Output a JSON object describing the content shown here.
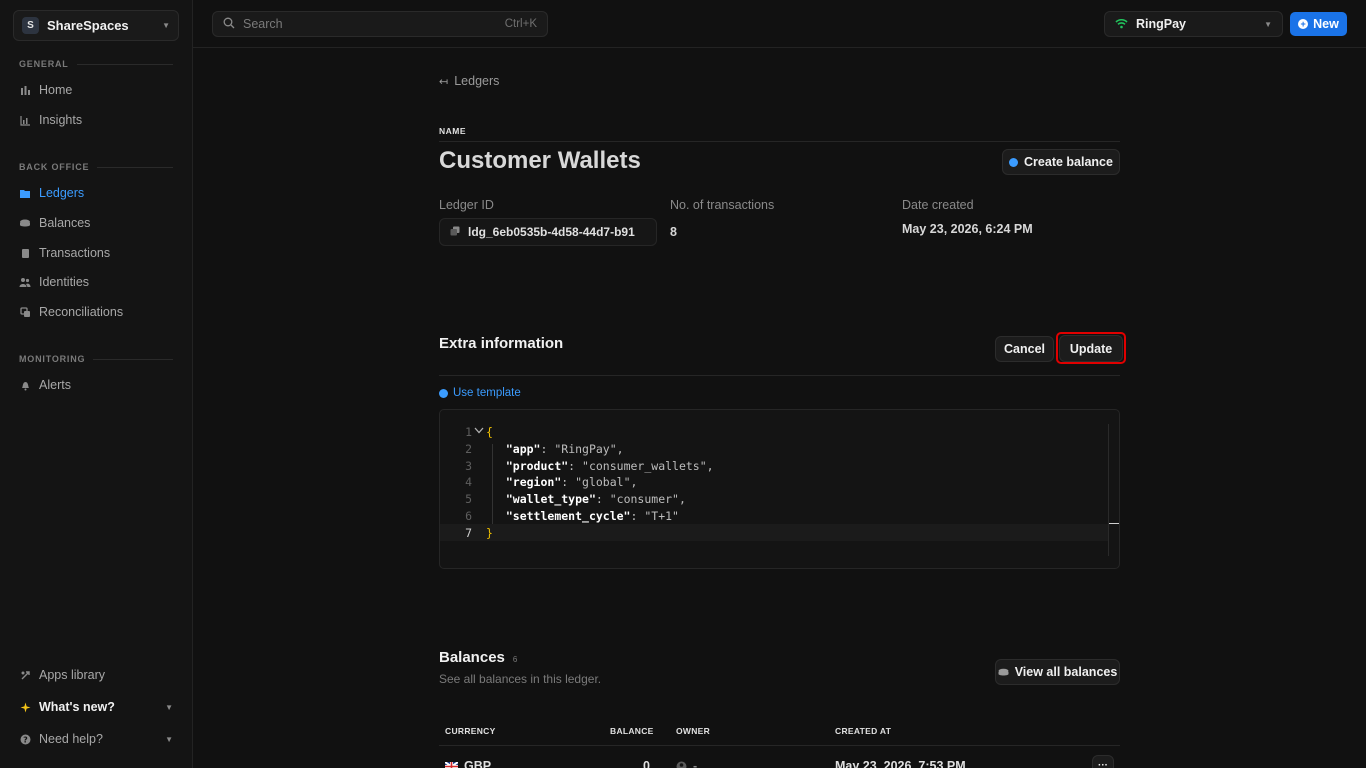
{
  "workspace": {
    "initial": "S",
    "name": "ShareSpaces"
  },
  "sidebar": {
    "sections": [
      {
        "label": "GENERAL"
      },
      {
        "label": "BACK OFFICE"
      },
      {
        "label": "MONITORING"
      }
    ],
    "items": [
      {
        "label": "Home",
        "icon": "home-icon"
      },
      {
        "label": "Insights",
        "icon": "chart-icon"
      },
      {
        "label": "Ledgers",
        "icon": "ledger-icon",
        "active": true
      },
      {
        "label": "Balances",
        "icon": "coins-icon"
      },
      {
        "label": "Transactions",
        "icon": "transactions-icon"
      },
      {
        "label": "Identities",
        "icon": "users-icon"
      },
      {
        "label": "Reconciliations",
        "icon": "reconcile-icon"
      },
      {
        "label": "Alerts",
        "icon": "bell-icon"
      }
    ],
    "footer": [
      {
        "label": "Apps library",
        "icon": "apps-icon"
      },
      {
        "label": "What's new?",
        "icon": "sparkle-icon"
      },
      {
        "label": "Need help?",
        "icon": "help-icon"
      }
    ]
  },
  "topbar": {
    "search_placeholder": "Search",
    "search_shortcut": "Ctrl+K",
    "app_name": "RingPay",
    "new_label": "New"
  },
  "ledger": {
    "back_label": "Ledgers",
    "name_label": "NAME",
    "name": "Customer Wallets",
    "create_balance_label": "Create balance",
    "meta": {
      "id_label": "Ledger ID",
      "id_value": "ldg_6eb0535b-4d58-44d7-b91",
      "tx_label": "No. of transactions",
      "tx_value": "8",
      "date_label": "Date created",
      "date_value": "May 23, 2026, 6:24 PM"
    }
  },
  "extra": {
    "title": "Extra information",
    "cancel_label": "Cancel",
    "update_label": "Update",
    "use_template_label": "Use template",
    "editor": {
      "line_numbers": [
        "1",
        "2",
        "3",
        "4",
        "5",
        "6",
        "7"
      ],
      "open_brace": "{",
      "close_brace": "}",
      "entries": [
        {
          "key": "\"app\"",
          "value": "\"RingPay\","
        },
        {
          "key": "\"product\"",
          "value": "\"consumer_wallets\","
        },
        {
          "key": "\"region\"",
          "value": "\"global\","
        },
        {
          "key": "\"wallet_type\"",
          "value": "\"consumer\","
        },
        {
          "key": "\"settlement_cycle\"",
          "value": "\"T+1\""
        }
      ]
    }
  },
  "balances": {
    "title": "Balances",
    "count": "6",
    "subtitle": "See all balances in this ledger.",
    "view_all_label": "View all balances",
    "columns": [
      "CURRENCY",
      "BALANCE",
      "OWNER",
      "CREATED AT"
    ],
    "rows": [
      {
        "currency": "GBP",
        "balance": "0",
        "owner": "-",
        "created_at": "May 23, 2026, 7:53 PM"
      }
    ]
  }
}
